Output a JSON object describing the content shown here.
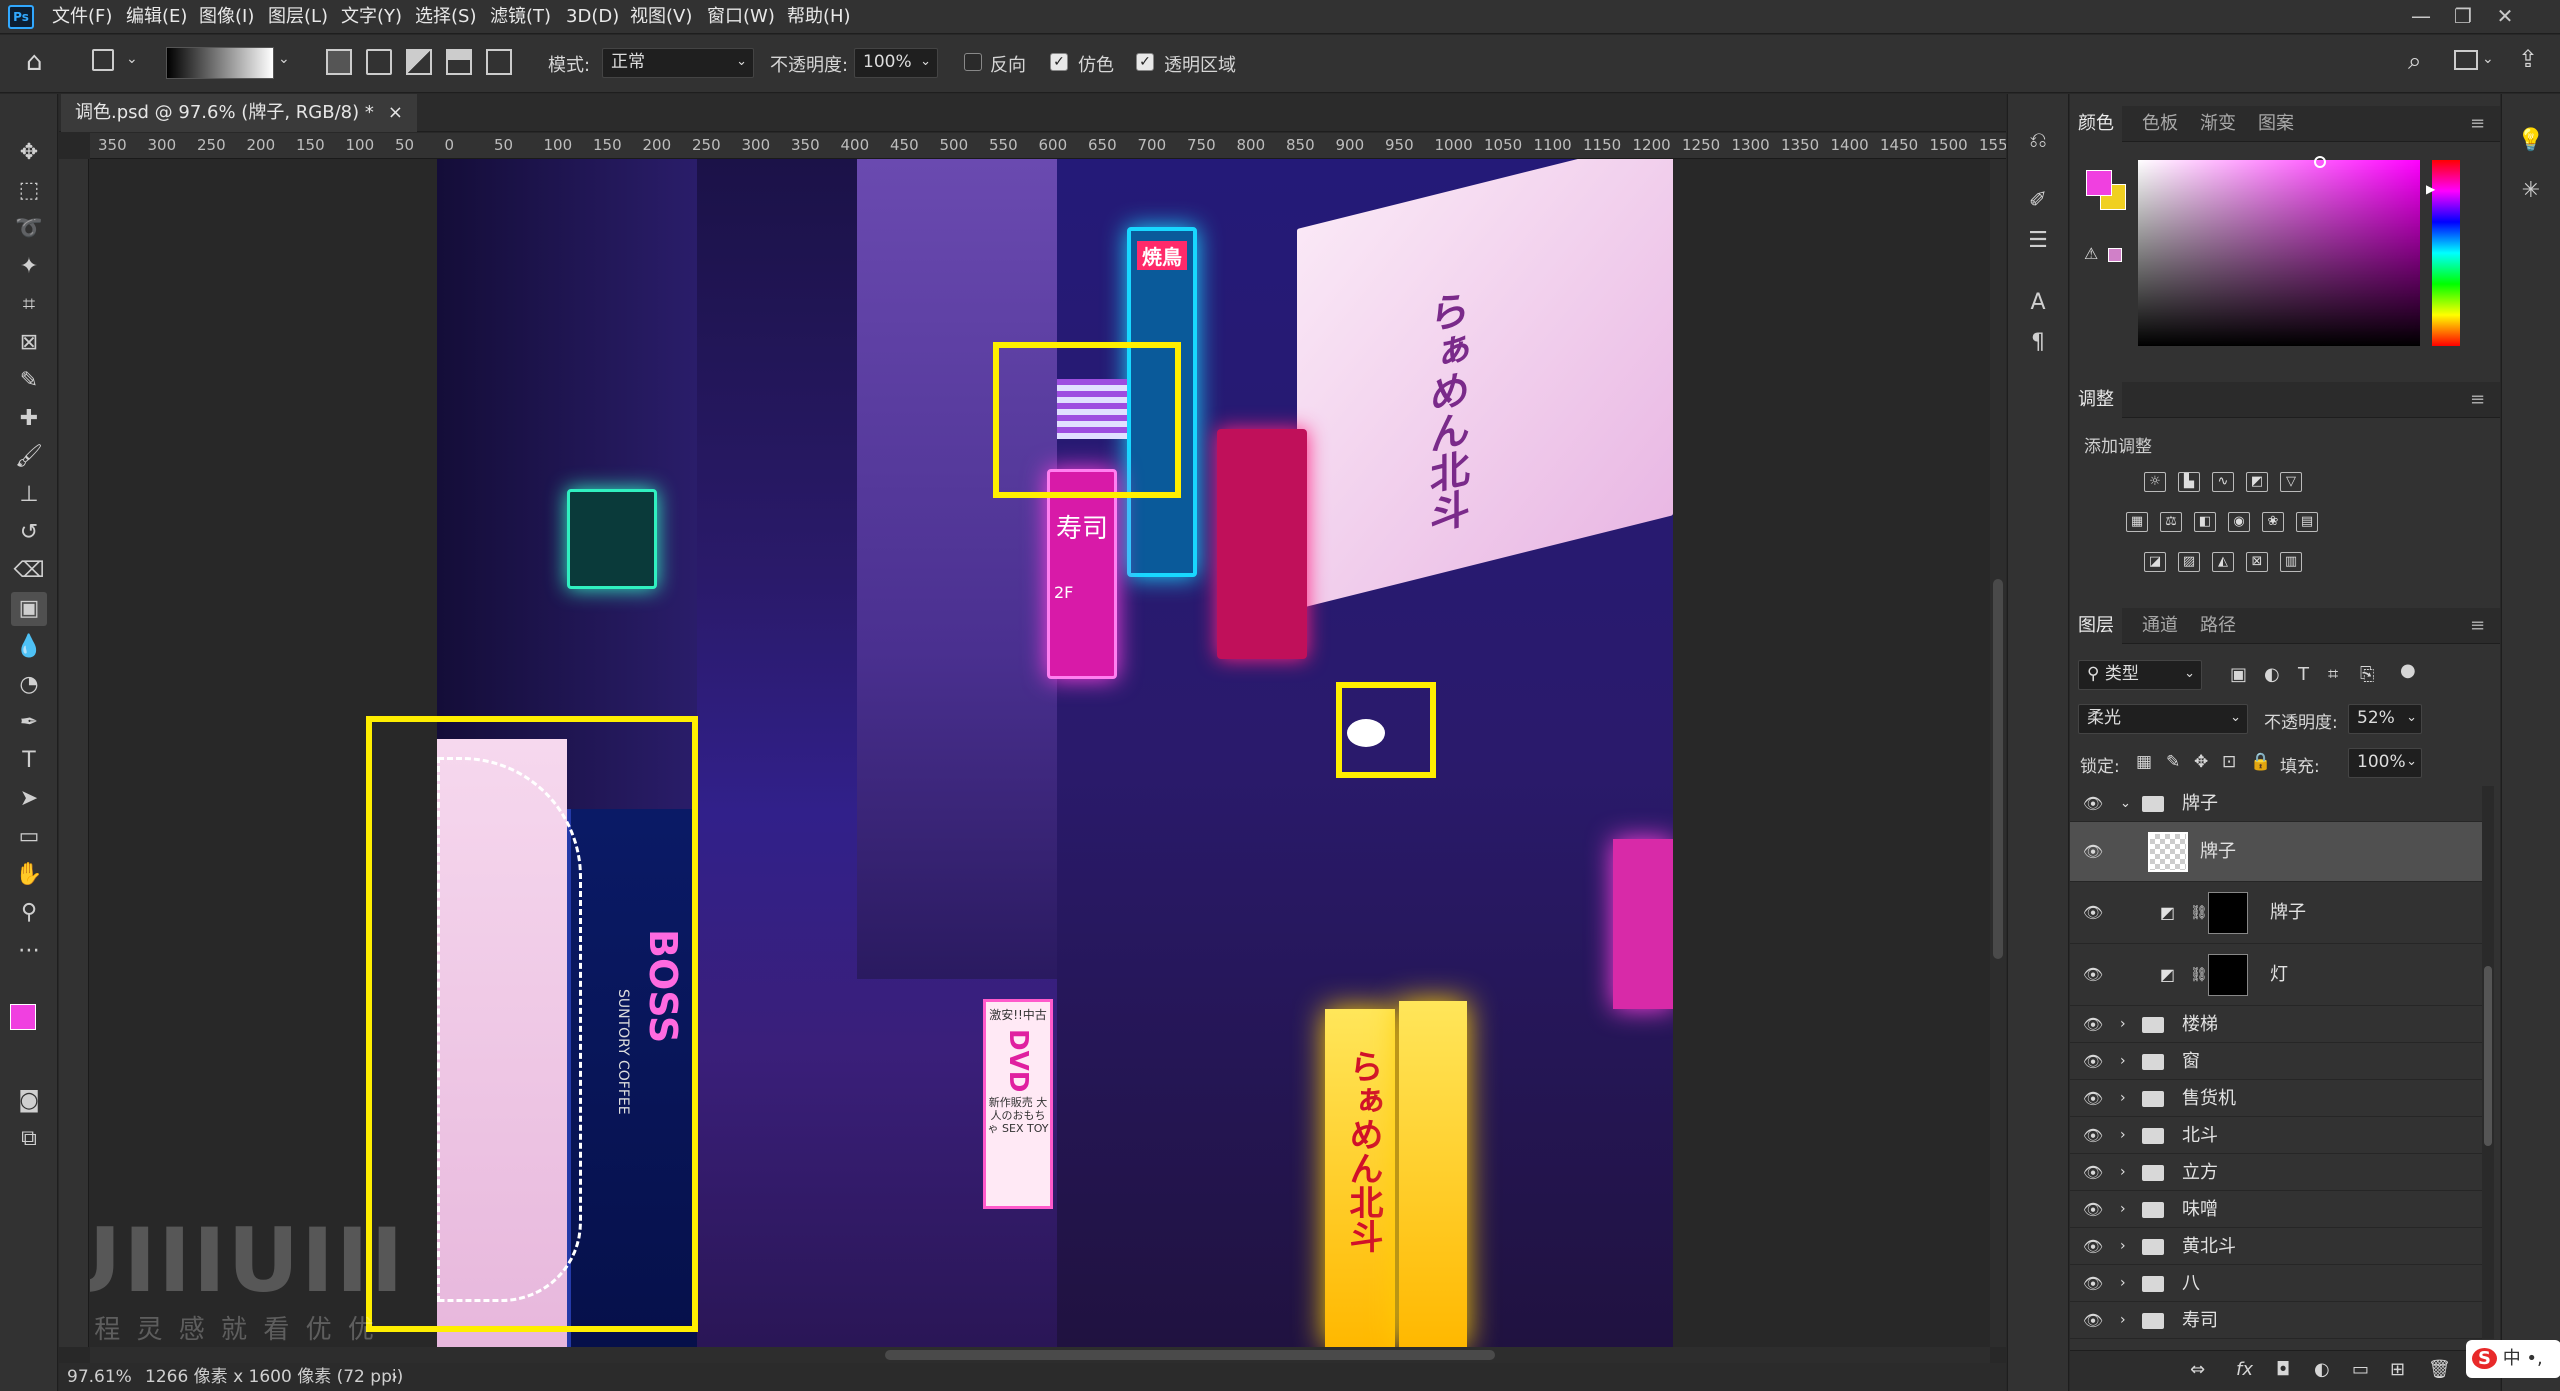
{
  "app": {
    "icon": "Ps"
  },
  "menu": [
    "文件(F)",
    "编辑(E)",
    "图像(I)",
    "图层(L)",
    "文字(Y)",
    "选择(S)",
    "滤镜(T)",
    "3D(D)",
    "视图(V)",
    "窗口(W)",
    "帮助(H)"
  ],
  "window_controls": {
    "minimize": "—",
    "restore": "❐",
    "close": "✕"
  },
  "options": {
    "mode_label": "模式:",
    "mode_value": "正常",
    "opacity_label": "不透明度:",
    "opacity_value": "100%",
    "reverse_label": "反向",
    "reverse_checked": false,
    "dither_label": "仿色",
    "dither_checked": true,
    "transparency_label": "透明区域",
    "transparency_checked": true
  },
  "document": {
    "tab_title": "调色.psd @ 97.6% (牌子, RGB/8) *",
    "close": "×"
  },
  "ruler_top": [
    "350",
    "300",
    "250",
    "200",
    "150",
    "100",
    "50",
    "0",
    "50",
    "100",
    "150",
    "200",
    "250",
    "300",
    "350",
    "400",
    "450",
    "500",
    "550",
    "600",
    "650",
    "700",
    "750",
    "800",
    "850",
    "900",
    "950",
    "1000",
    "1050",
    "1100",
    "1150",
    "1200",
    "1250",
    "1300",
    "1350",
    "1400",
    "1450",
    "1500",
    "155"
  ],
  "status": {
    "zoom": "97.61%",
    "size": "1266 像素 x 1600 像素 (72 ppi)",
    "arrow": "›"
  },
  "scene_text": {
    "yakitori": "焼鳥",
    "ramen_sign": "らぁめん北斗",
    "sushi": "寿司",
    "floor": "2F",
    "boss": "BOSS",
    "suntory": "SUNTORY COFFEE",
    "dvd": "DVD",
    "dvd_top": "激安!!中古",
    "dvd_bottom": "新作販売 大人のおもちゃ SEX TOY",
    "ramen_bottom": "らぁめん北斗"
  },
  "watermark": {
    "logo": "UIIIUIII",
    "text": "教 程 灵 感 就 看 优 优"
  },
  "color_panel": {
    "tabs": [
      "颜色",
      "色板",
      "渐变",
      "图案"
    ],
    "fg": "#f040e0",
    "bg": "#f0d020"
  },
  "adjust_panel": {
    "title": "调整",
    "subtitle": "添加调整"
  },
  "layers_panel": {
    "tabs": [
      "图层",
      "通道",
      "路径"
    ],
    "filter": "类型",
    "blend": "柔光",
    "opacity_label": "不透明度:",
    "opacity_value": "52%",
    "lock_label": "锁定:",
    "fill_label": "填充:",
    "fill_value": "100%",
    "layers": [
      {
        "name": "牌子",
        "kind": "group-open"
      },
      {
        "name": "牌子",
        "kind": "pixel-selected"
      },
      {
        "name": "牌子",
        "kind": "adjust"
      },
      {
        "name": "灯",
        "kind": "adjust"
      },
      {
        "name": "楼梯",
        "kind": "group"
      },
      {
        "name": "窗",
        "kind": "group"
      },
      {
        "name": "售货机",
        "kind": "group"
      },
      {
        "name": "北斗",
        "kind": "group"
      },
      {
        "name": "立方",
        "kind": "group"
      },
      {
        "name": "味噌",
        "kind": "group"
      },
      {
        "name": "黄北斗",
        "kind": "group"
      },
      {
        "name": "八",
        "kind": "group"
      },
      {
        "name": "寿司",
        "kind": "group"
      }
    ],
    "footer": [
      "⇔",
      "fx",
      "◘",
      "◐",
      "▭",
      "⊞",
      "🗑"
    ]
  },
  "ime": {
    "logo": "S",
    "text": "中 •,"
  }
}
